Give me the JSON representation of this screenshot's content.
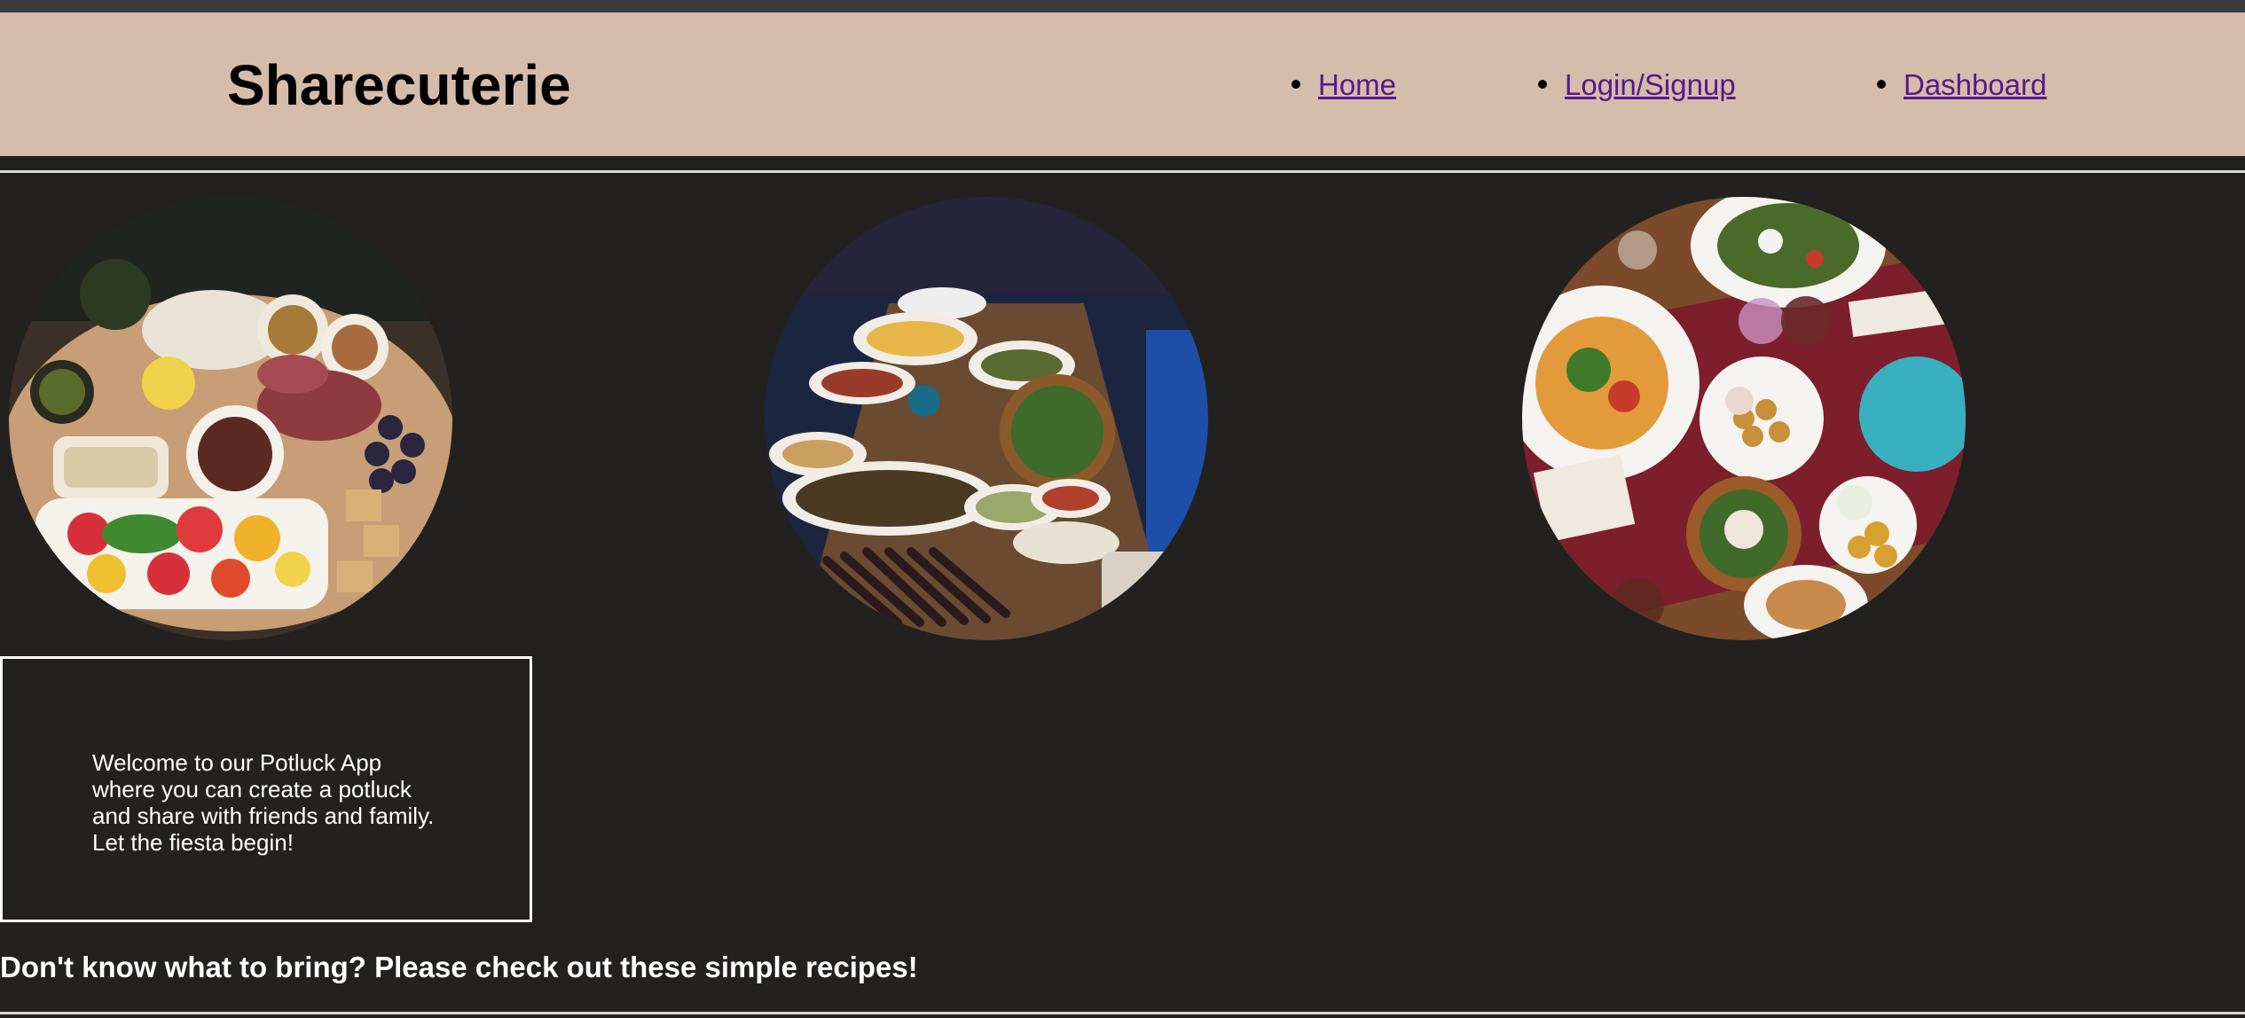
{
  "header": {
    "brand": "Sharecuterie",
    "background_color": "#d5bcab",
    "nav": [
      {
        "label": "Home"
      },
      {
        "label": "Login/Signup"
      },
      {
        "label": "Dashboard"
      }
    ],
    "link_color": "#551a8b"
  },
  "gallery": {
    "images": [
      {
        "alt": "charcuterie-board-photo"
      },
      {
        "alt": "potluck-table-photo"
      },
      {
        "alt": "dinner-table-photo"
      }
    ]
  },
  "welcome": {
    "text": "Welcome to our Potluck App where you can create a potluck and share with friends and family. Let the fiesta begin!"
  },
  "recipes": {
    "heading": "Don't know what to bring? Please check out these simple recipes!"
  },
  "colors": {
    "page_background": "#222120",
    "text": "#ffffff"
  }
}
